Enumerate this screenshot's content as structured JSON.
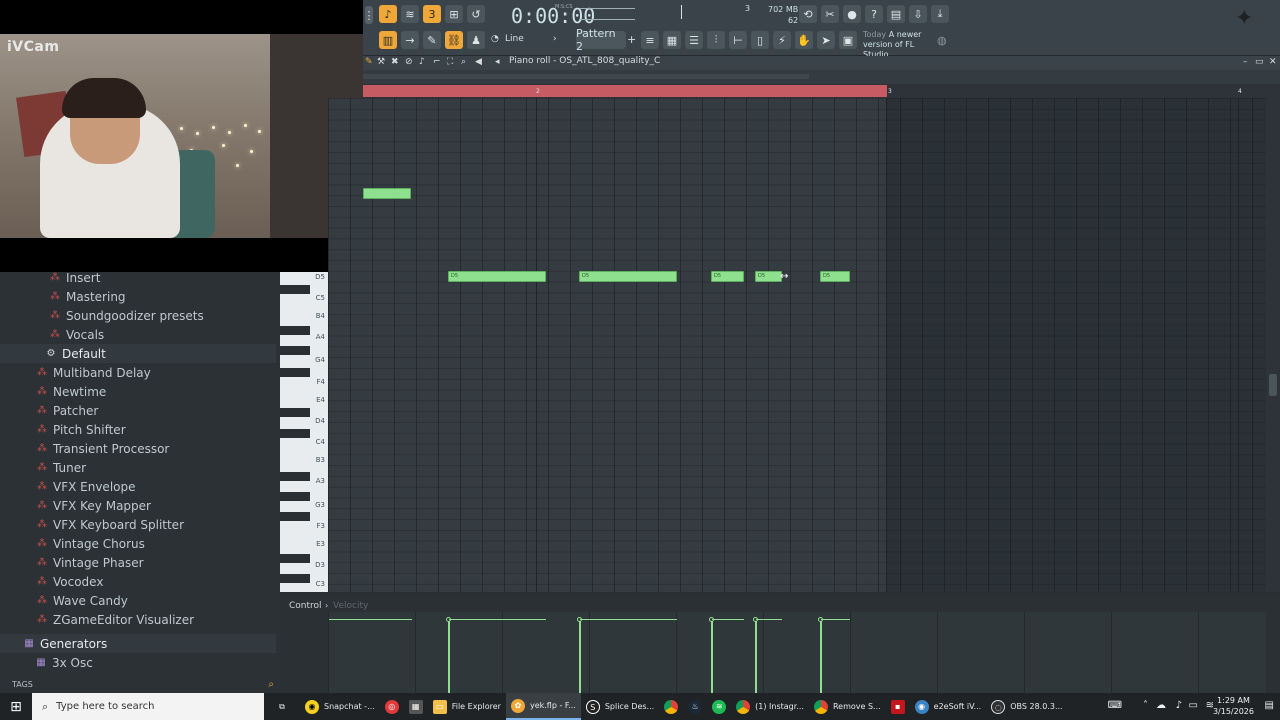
{
  "webcam": {
    "label": "iVCam"
  },
  "toolbar": {
    "time": "0:00:00",
    "time_unit": "M:S:CS",
    "snap": "Line",
    "pattern": "Pattern 2",
    "cpu_num": "3",
    "memory": "702 MB",
    "polyphony": "62",
    "news_label": "Today",
    "news_text": "A newer version of FL Studio..."
  },
  "piano_roll": {
    "title": "Piano roll - OS_ATL_808_quality_C",
    "ruler_marks": [
      "2",
      "3",
      "4"
    ],
    "key_labels": [
      "D5",
      "C5",
      "B4",
      "A4",
      "G4",
      "F4",
      "E4",
      "D4",
      "C4",
      "B3",
      "A3",
      "G3",
      "F3",
      "E3",
      "D3",
      "C3"
    ],
    "notes": [
      {
        "label": "",
        "row": "G5"
      },
      {
        "label": "D5"
      },
      {
        "label": "D5"
      },
      {
        "label": "D5"
      },
      {
        "label": "D5"
      },
      {
        "label": "D5"
      }
    ],
    "note_color": "#8fe08e",
    "loop_color": "#c75b64"
  },
  "browser": {
    "items": [
      {
        "label": "Insert",
        "icon": "folder-icon",
        "indent": 2
      },
      {
        "label": "Mastering",
        "icon": "plug-icon",
        "indent": 2
      },
      {
        "label": "Soundgoodizer presets",
        "icon": "plug-icon",
        "indent": 2
      },
      {
        "label": "Vocals",
        "icon": "plug-icon",
        "indent": 2
      },
      {
        "label": "Default",
        "icon": "gear-icon",
        "indent": 1
      },
      {
        "label": "Multiband Delay",
        "icon": "plug-icon",
        "indent": 1
      },
      {
        "label": "Newtime",
        "icon": "plug-icon",
        "indent": 1
      },
      {
        "label": "Patcher",
        "icon": "plug-icon",
        "indent": 1
      },
      {
        "label": "Pitch Shifter",
        "icon": "plug-icon",
        "indent": 1
      },
      {
        "label": "Transient Processor",
        "icon": "plug-icon",
        "indent": 1
      },
      {
        "label": "Tuner",
        "icon": "plug-icon",
        "indent": 1
      },
      {
        "label": "VFX Envelope",
        "icon": "plug-icon",
        "indent": 1
      },
      {
        "label": "VFX Key Mapper",
        "icon": "plug-icon",
        "indent": 1
      },
      {
        "label": "VFX Keyboard Splitter",
        "icon": "plug-icon",
        "indent": 1
      },
      {
        "label": "Vintage Chorus",
        "icon": "plug-icon",
        "indent": 1
      },
      {
        "label": "Vintage Phaser",
        "icon": "plug-icon",
        "indent": 1
      },
      {
        "label": "Vocodex",
        "icon": "plug-icon",
        "indent": 1
      },
      {
        "label": "Wave Candy",
        "icon": "plug-icon",
        "indent": 1
      },
      {
        "label": "ZGameEditor Visualizer",
        "icon": "plug-icon",
        "indent": 1
      },
      {
        "label": "Generators",
        "icon": "folder-icon",
        "indent": 0
      },
      {
        "label": "3x Osc",
        "icon": "folder-icon",
        "indent": 1
      }
    ],
    "tags_label": "TAGS"
  },
  "control": {
    "label": "Control",
    "param": "Velocity"
  },
  "taskbar": {
    "search_placeholder": "Type here to search",
    "apps": [
      {
        "label": "Snapchat -...",
        "color": "#f7d11b"
      },
      {
        "label": "",
        "color": "#e23a3a"
      },
      {
        "label": "",
        "color": "#555555"
      },
      {
        "label": "File Explorer",
        "color": "#f2c04a"
      },
      {
        "label": "yek.flp - F...",
        "color": "#f0a73a"
      },
      {
        "label": "Splice Des...",
        "color": "#222222"
      },
      {
        "label": "",
        "color": "#34a853"
      },
      {
        "label": "",
        "color": "#1b2838"
      },
      {
        "label": "",
        "color": "#1db954"
      },
      {
        "label": "(1) Instagr...",
        "color": "#db4437"
      },
      {
        "label": "Remove S...",
        "color": "#db4437"
      },
      {
        "label": "",
        "color": "#c4161c"
      },
      {
        "label": "e2eSoft iV...",
        "color": "#3b82c4"
      },
      {
        "label": "OBS 28.0.3...",
        "color": "#303030"
      }
    ],
    "time": "1:29 AM",
    "date": "3/15/2026"
  }
}
